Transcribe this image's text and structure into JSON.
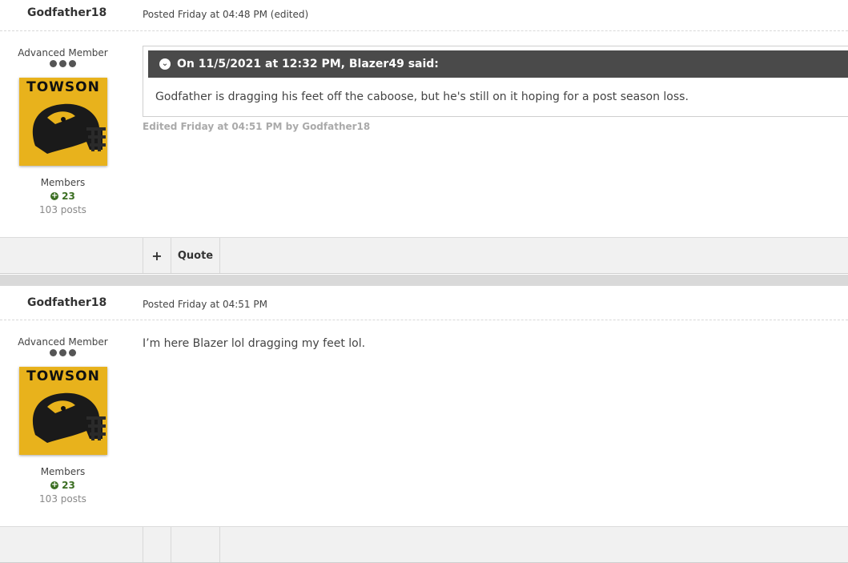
{
  "posts": [
    {
      "author": "Godfather18",
      "meta": "Posted Friday at 04:48 PM (edited)",
      "member_title": "Advanced Member",
      "avatar_text": "TOWSON",
      "group": "Members",
      "reputation": "23",
      "post_count": "103 posts",
      "quote": {
        "citation": "On 11/5/2021 at 12:32 PM, Blazer49 said:",
        "text": "Godfather is dragging his feet off the caboose, but he's still on it hoping for a post season loss."
      },
      "edited_note": "Edited Friday at 04:51 PM by Godfather18",
      "controls": {
        "plus": "+",
        "quote": "Quote"
      }
    },
    {
      "author": "Godfather18",
      "meta": "Posted Friday at 04:51 PM",
      "member_title": "Advanced Member",
      "avatar_text": "TOWSON",
      "group": "Members",
      "reputation": "23",
      "post_count": "103 posts",
      "text": "I’m here Blazer lol dragging my feet lol."
    }
  ],
  "colors": {
    "reputation_green": "#3b6e22",
    "quote_header": "#4a4a4a",
    "avatar_gold": "#e8b21c"
  }
}
